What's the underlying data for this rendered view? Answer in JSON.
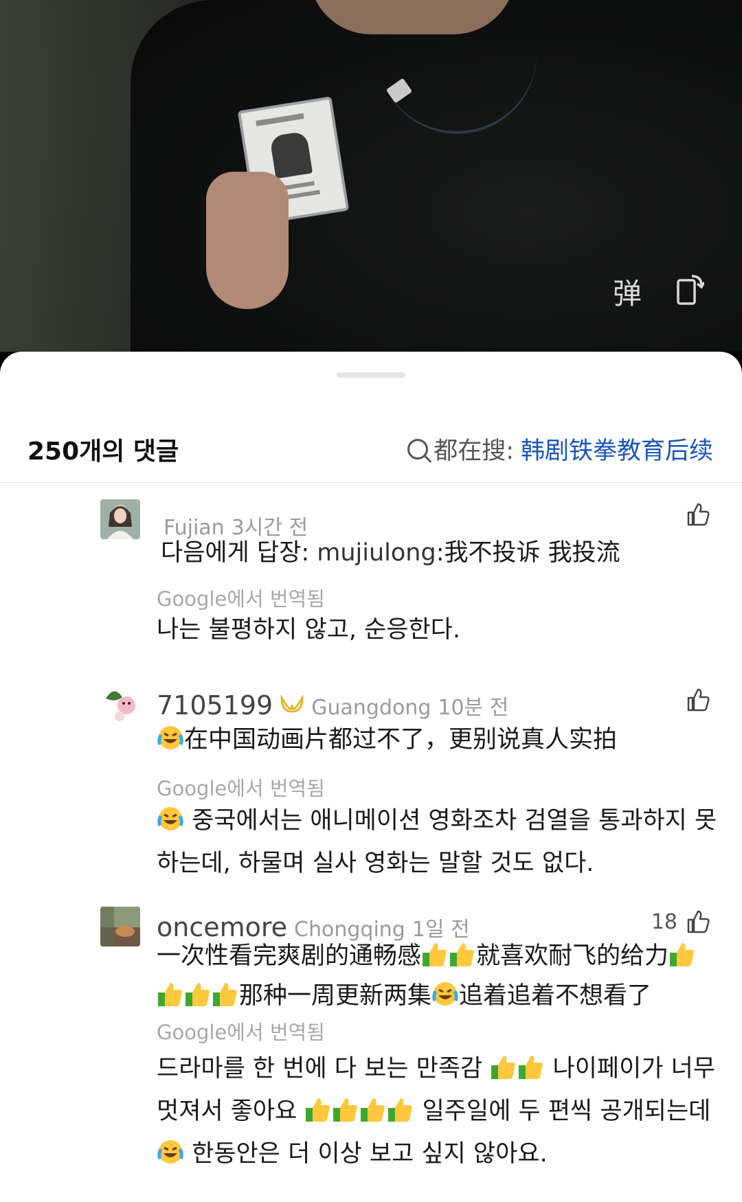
{
  "video": {
    "danmaku_icon": "弹",
    "icons": [
      "danmaku-icon",
      "rotate-screen-icon"
    ]
  },
  "sheet": {
    "comment_count": "250개의 댓글",
    "search_prefix": "都在搜:",
    "search_term": "韩剧铁拳教育后续"
  },
  "comments": [
    {
      "user": "",
      "location": "Fujian",
      "time": "3시간 전",
      "likes": "",
      "text_prefix": "다음에게 답장: ",
      "text_reply_user": "mujiulong",
      "text": ":我不投诉 我投流",
      "translated_by": "Google에서 번역됨",
      "translation": "나는 불평하지 않고, 순응한다."
    },
    {
      "user": "7105199",
      "location": "Guangdong",
      "time": "10분 전",
      "likes": "",
      "text": "在中国动画片都过不了，更别说真人实拍",
      "translated_by": "Google에서 번역됨",
      "translation": "중국에서는 애니메이션 영화조차 검열을 통과하지 못하는데, 하물며 실사 영화는 말할 것도 없다."
    },
    {
      "user": "oncemore",
      "location": "Chongqing",
      "time": "1일 전",
      "likes": "18",
      "text_a": "一次性看完爽剧的通畅感",
      "text_b": "就喜欢耐飞的给力",
      "text_c": "那种一周更新两集",
      "text_d": "追着追着不想看了",
      "translated_by": "Google에서 번역됨",
      "translation_a": "드라마를 한 번에 다 보는 만족감",
      "translation_b": "나이페이가 너무 멋져서 좋아요",
      "translation_c": "일주일에 두 편씩 공개되는데",
      "translation_d": "한동안은 더 이상 보고 싶지 않아요."
    }
  ]
}
